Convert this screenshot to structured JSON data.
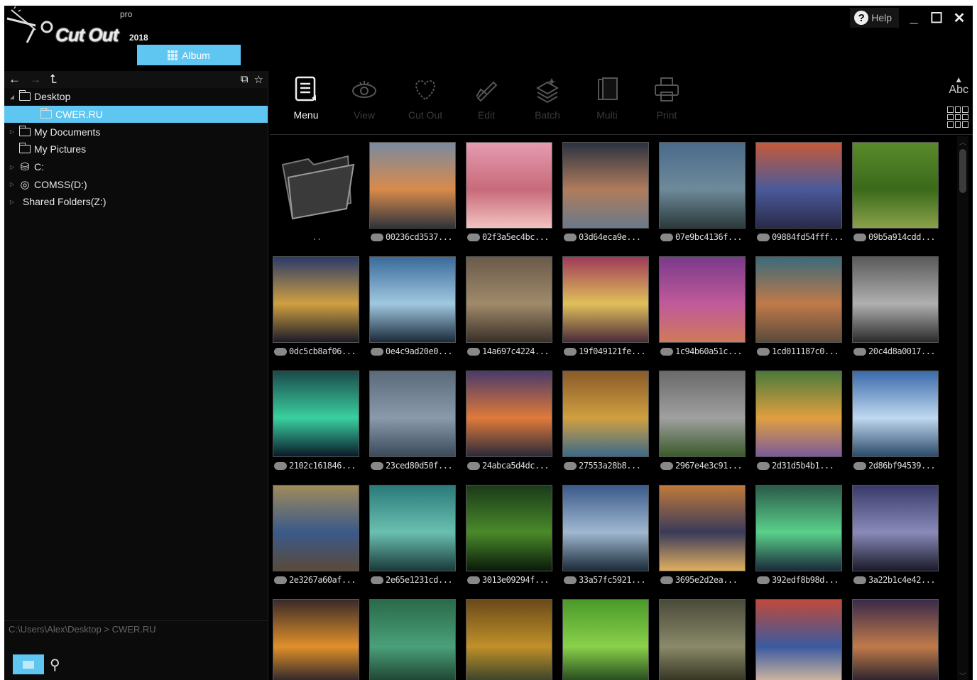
{
  "app": {
    "logo_text": "Cut Out",
    "logo_pro": "pro",
    "logo_year": "2018",
    "album_tab": "Album",
    "help_label": "Help"
  },
  "window_controls": {
    "minimize": "_",
    "maximize": "☐",
    "close": "✕"
  },
  "nav": {
    "back": "←",
    "forward": "→",
    "up": "⮤"
  },
  "tree": [
    {
      "label": "Desktop",
      "expanded": true,
      "icon": "folder-icon"
    },
    {
      "label": "CWER.RU",
      "selected": true,
      "icon": "folder-icon"
    },
    {
      "label": "My Documents",
      "icon": "folder-icon"
    },
    {
      "label": "My Pictures",
      "icon": "folder-icon"
    },
    {
      "label": "C:",
      "icon": "drive-icon"
    },
    {
      "label": "COMSS(D:)",
      "icon": "disc-icon"
    },
    {
      "label": "Shared Folders(Z:)",
      "icon": "network-icon"
    }
  ],
  "path": "C:\\Users\\Alex\\Desktop > CWER.RU",
  "toolbar": [
    {
      "label": "Menu",
      "active": true,
      "icon": "menu-icon"
    },
    {
      "label": "View",
      "icon": "eye-icon"
    },
    {
      "label": "Cut Out",
      "icon": "heart-cut-icon"
    },
    {
      "label": "Edit",
      "icon": "edit-icon"
    },
    {
      "label": "Batch",
      "icon": "batch-icon"
    },
    {
      "label": "Multi",
      "icon": "multi-icon"
    },
    {
      "label": "Print",
      "icon": "printer-icon"
    }
  ],
  "sort_label": "Abc",
  "folder_up_label": "..",
  "thumbnails": [
    "00236cd3537...",
    "02f3a5ec4bc...",
    "03d64eca9e...",
    "07e9bc4136f...",
    "09884fd54fff...",
    "09b5a914cdd...",
    "0dc5cb8af06...",
    "0e4c9ad20e0...",
    "14a697c4224...",
    "19f049121fe...",
    "1c94b60a51c...",
    "1cd011187c0...",
    "20c4d8a0017...",
    "2102c161846...",
    "23ced80d50f...",
    "24abca5d4dc...",
    "27553a28b8...",
    "2967e4e3c91...",
    "2d31d5b4b1...",
    "2d86bf94539...",
    "2e3267a60af...",
    "2e65e1231cd...",
    "3013e09294f...",
    "33a57fc5921...",
    "3695e2d2ea...",
    "392edf8b98d...",
    "3a22b1c4e42...",
    "",
    "",
    "",
    "",
    "",
    "",
    ""
  ],
  "colors": {
    "accent": "#5fc6f2",
    "background": "#000000",
    "panel": "#0b0b0b"
  }
}
